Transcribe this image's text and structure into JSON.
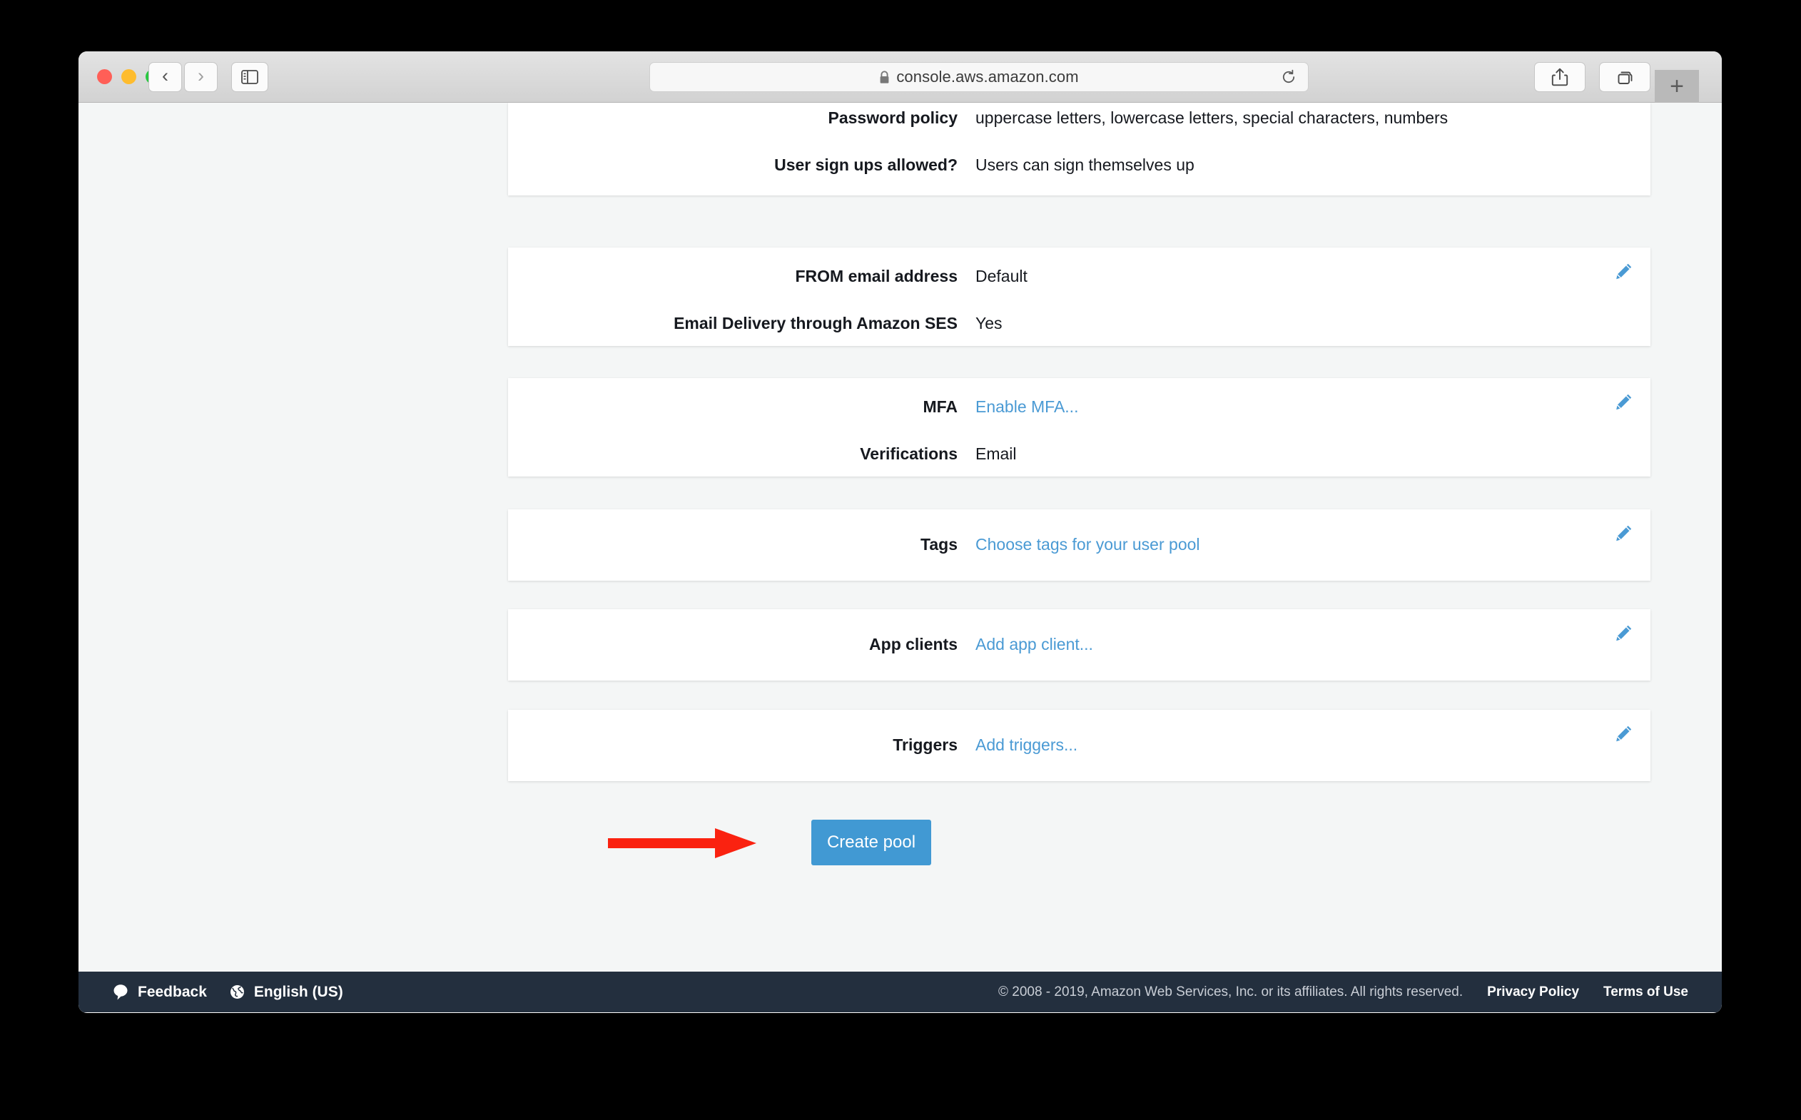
{
  "browser": {
    "url": "console.aws.amazon.com",
    "lock_icon": "lock-icon",
    "back_icon": "chevron-left-icon",
    "forward_icon": "chevron-right-icon",
    "sidebar_icon": "sidebar-toggle-icon",
    "reload_icon": "reload-icon",
    "share_icon": "share-icon",
    "tabs_icon": "tab-overview-icon",
    "new_tab_label": "+"
  },
  "cards": [
    {
      "id": "card-password",
      "has_edit": false,
      "rows": [
        {
          "label": "Password policy",
          "value": "uppercase letters, lowercase letters, special characters, numbers",
          "is_link": false
        },
        {
          "label": "User sign ups allowed?",
          "value": "Users can sign themselves up",
          "is_link": false
        }
      ]
    },
    {
      "id": "card-email",
      "has_edit": true,
      "rows": [
        {
          "label": "FROM email address",
          "value": "Default",
          "is_link": false
        },
        {
          "label": "Email Delivery through Amazon SES",
          "value": "Yes",
          "is_link": false
        }
      ]
    },
    {
      "id": "card-mfa",
      "has_edit": true,
      "rows": [
        {
          "label": "MFA",
          "value": "Enable MFA...",
          "is_link": true
        },
        {
          "label": "Verifications",
          "value": "Email",
          "is_link": false
        }
      ]
    },
    {
      "id": "card-tags",
      "has_edit": true,
      "rows": [
        {
          "label": "Tags",
          "value": "Choose tags for your user pool",
          "is_link": true
        }
      ]
    },
    {
      "id": "card-appclients",
      "has_edit": true,
      "rows": [
        {
          "label": "App clients",
          "value": "Add app client...",
          "is_link": true
        }
      ]
    },
    {
      "id": "card-triggers",
      "has_edit": true,
      "rows": [
        {
          "label": "Triggers",
          "value": "Add triggers...",
          "is_link": true
        }
      ]
    }
  ],
  "main": {
    "create_pool_label": "Create pool",
    "annotation_arrow": "red-arrow-pointing-right"
  },
  "footer": {
    "feedback_label": "Feedback",
    "feedback_icon": "speech-bubble-icon",
    "language_label": "English (US)",
    "language_icon": "globe-icon",
    "copyright": "© 2008 - 2019, Amazon Web Services, Inc. or its affiliates. All rights reserved.",
    "privacy_policy_label": "Privacy Policy",
    "terms_of_use_label": "Terms of Use"
  },
  "colors": {
    "accent_blue": "#4199d3",
    "link_blue": "#4a9ad4",
    "footer_dark": "#232f3e",
    "page_bg": "#f4f6f6",
    "annotation_red": "#fa2210"
  }
}
